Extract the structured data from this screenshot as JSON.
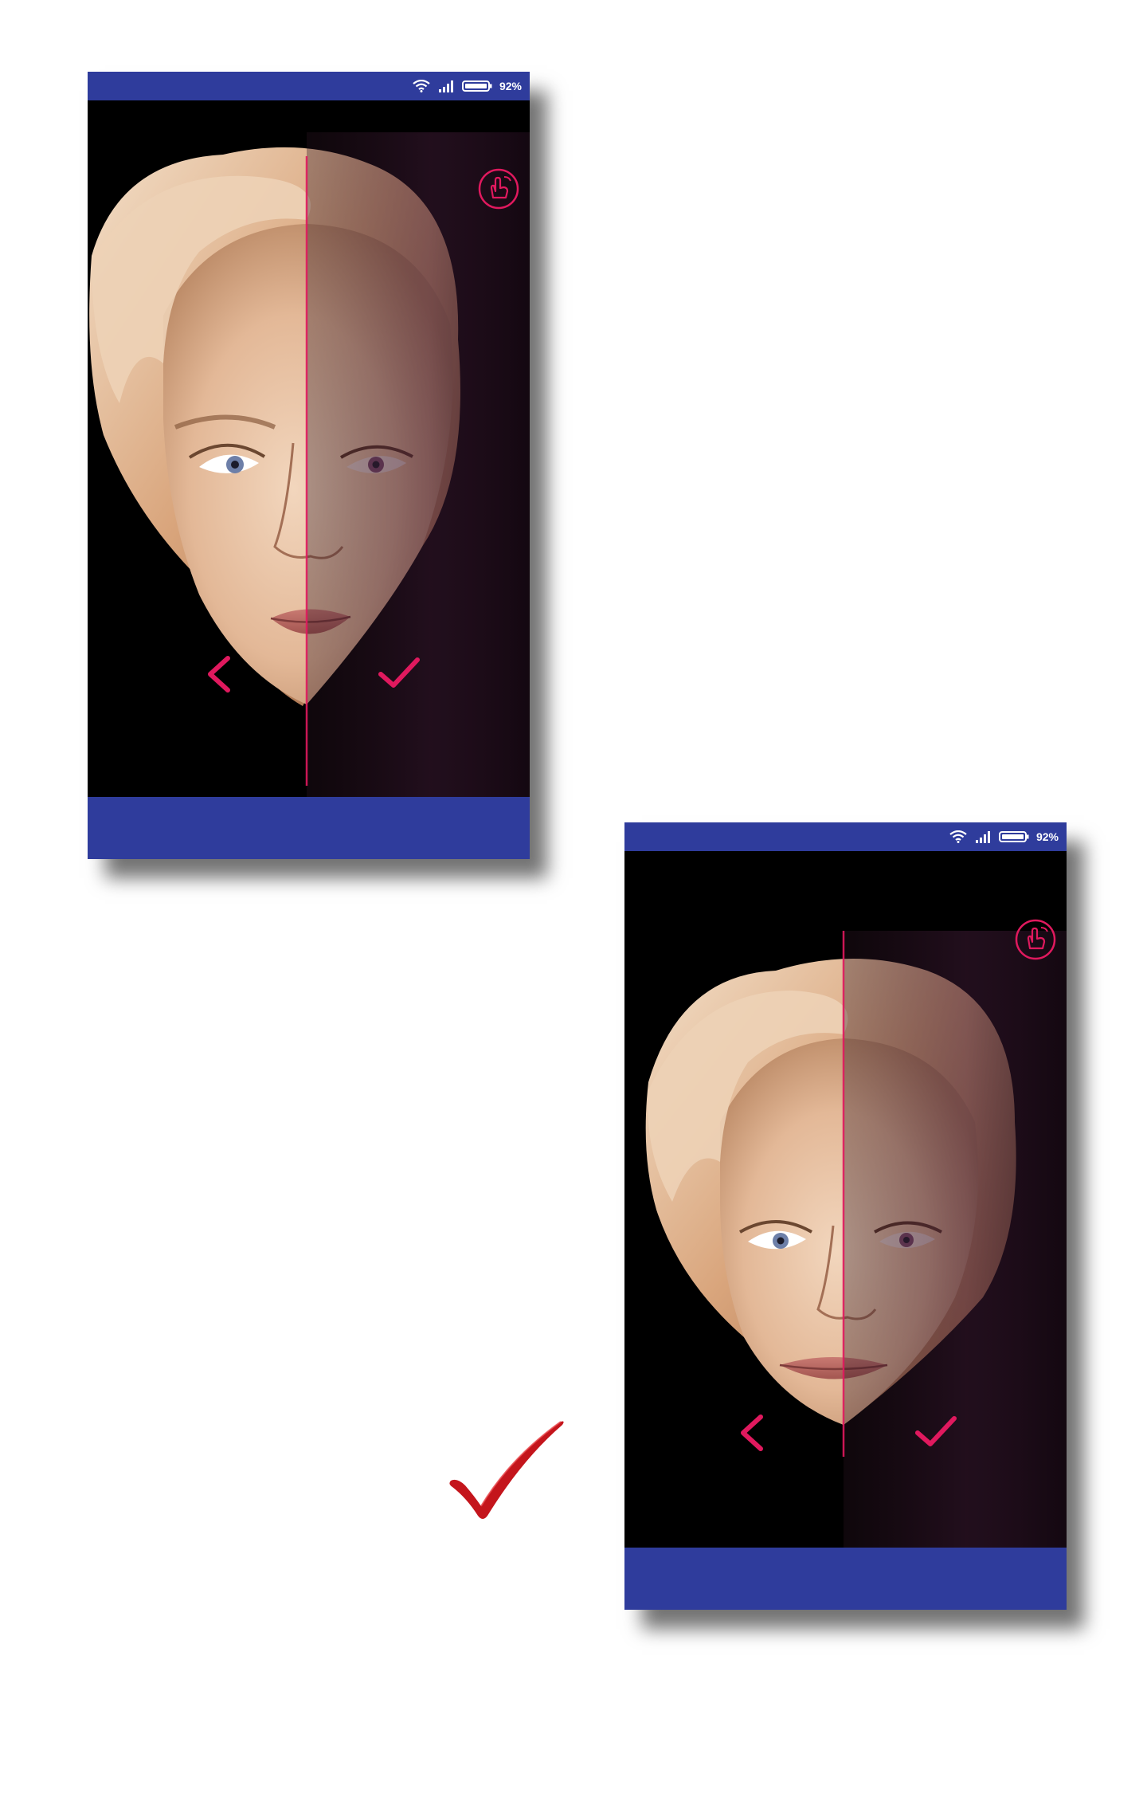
{
  "screens": [
    {
      "status_bar": {
        "battery": "92%",
        "icons": [
          "wifi-icon",
          "signal-icon",
          "battery-icon"
        ]
      },
      "controls": {
        "top_right": "gesture-hand-icon",
        "back": "chevron-left-icon",
        "confirm": "checkmark-icon"
      }
    },
    {
      "status_bar": {
        "battery": "92%",
        "icons": [
          "wifi-icon",
          "signal-icon",
          "battery-icon"
        ]
      },
      "controls": {
        "top_right": "gesture-hand-icon",
        "back": "chevron-left-icon",
        "confirm": "checkmark-icon"
      }
    }
  ],
  "annotation": {
    "icon": "checkmark-icon"
  },
  "colors": {
    "bar": "#2f3c9c",
    "accent": "#e0195e",
    "screen_bg": "#000000",
    "annotation": "#c4151c"
  }
}
